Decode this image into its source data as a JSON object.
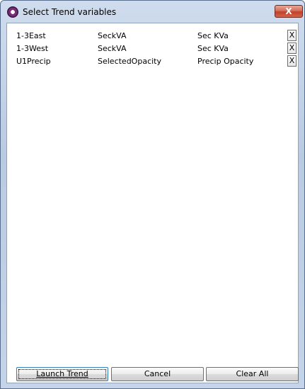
{
  "window": {
    "title": "Select Trend variables",
    "close_label": "X"
  },
  "rows": [
    {
      "name": "1-3East",
      "variable": "SeckVA",
      "description": "Sec KVa",
      "remove_label": "X"
    },
    {
      "name": "1-3West",
      "variable": "SeckVA",
      "description": "Sec KVa",
      "remove_label": "X"
    },
    {
      "name": "U1Precip",
      "variable": "SelectedOpacity",
      "description": "Precip Opacity",
      "remove_label": "X"
    }
  ],
  "buttons": {
    "launch": "Launch Trend",
    "cancel": "Cancel",
    "clear": "Clear All"
  },
  "colors": {
    "title_bar": "#c5d4e8",
    "close_button": "#c7472f",
    "background": "#ffffff"
  }
}
